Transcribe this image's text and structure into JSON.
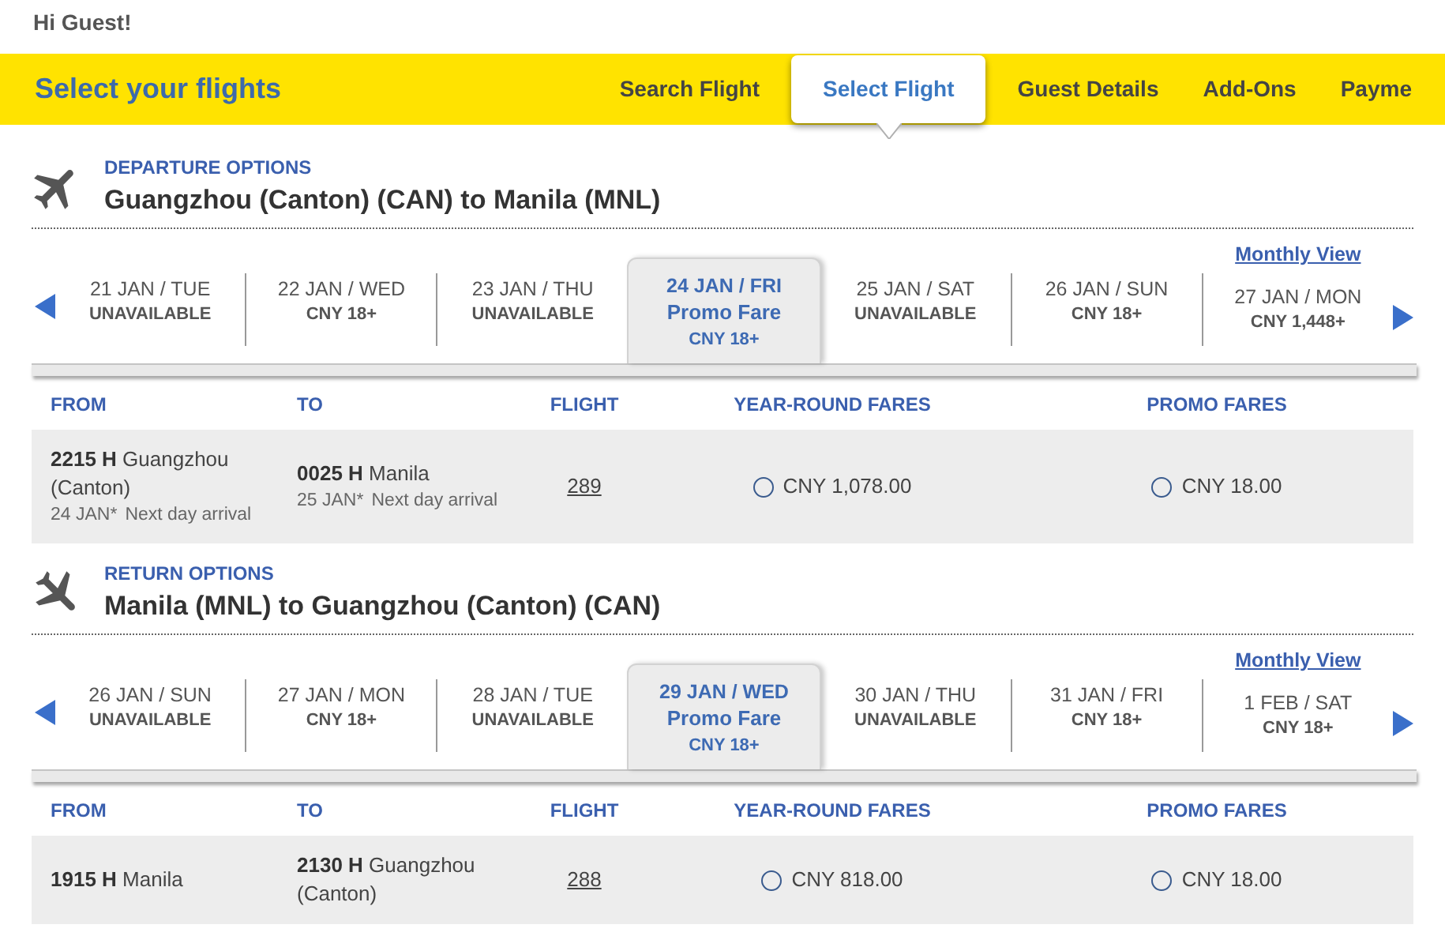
{
  "greeting": "Hi Guest!",
  "header": {
    "title": "Select your flights",
    "steps": [
      {
        "label": "Search Flight",
        "selected": false
      },
      {
        "label": "Select Flight",
        "selected": true
      },
      {
        "label": "Guest Details",
        "selected": false
      },
      {
        "label": "Add-Ons",
        "selected": false
      },
      {
        "label": "Payme",
        "selected": false
      }
    ]
  },
  "sections": [
    {
      "kind": "departure",
      "heading": "DEPARTURE OPTIONS",
      "route": "Guangzhou (Canton) (CAN) to Manila (MNL)",
      "monthly_view": "Monthly View",
      "dates": [
        {
          "date": "21 JAN / TUE",
          "fare": "UNAVAILABLE",
          "selected": false
        },
        {
          "date": "22 JAN / WED",
          "fare": "CNY 18+",
          "selected": false
        },
        {
          "date": "23 JAN / THU",
          "fare": "UNAVAILABLE",
          "selected": false
        },
        {
          "date": "24 JAN / FRI",
          "fare_type": "Promo Fare",
          "fare": "CNY 18+",
          "selected": true
        },
        {
          "date": "25 JAN / SAT",
          "fare": "UNAVAILABLE",
          "selected": false
        },
        {
          "date": "26 JAN / SUN",
          "fare": "CNY 18+",
          "selected": false
        },
        {
          "date": "27 JAN / MON",
          "fare": "CNY 1,448+",
          "selected": false
        }
      ],
      "columns": [
        "FROM",
        "TO",
        "FLIGHT",
        "YEAR-ROUND FARES",
        "PROMO FARES"
      ],
      "flights": [
        {
          "depart_time": "2215 H",
          "depart_city": "Guangzhou (Canton)",
          "depart_date": "24 JAN*",
          "depart_note": "Next day arrival",
          "arrive_time": "0025 H",
          "arrive_city": "Manila",
          "arrive_date": "25 JAN*",
          "arrive_note": "Next day arrival",
          "flight_number": "289",
          "fares": [
            {
              "price": "CNY 1,078.00",
              "selected": false
            },
            {
              "price": "CNY 18.00",
              "selected": false
            }
          ]
        }
      ]
    },
    {
      "kind": "return",
      "heading": "RETURN OPTIONS",
      "route": "Manila (MNL) to Guangzhou (Canton) (CAN)",
      "monthly_view": "Monthly View",
      "dates": [
        {
          "date": "26 JAN / SUN",
          "fare": "UNAVAILABLE",
          "selected": false
        },
        {
          "date": "27 JAN / MON",
          "fare": "CNY 18+",
          "selected": false
        },
        {
          "date": "28 JAN / TUE",
          "fare": "UNAVAILABLE",
          "selected": false
        },
        {
          "date": "29 JAN / WED",
          "fare_type": "Promo Fare",
          "fare": "CNY 18+",
          "selected": true
        },
        {
          "date": "30 JAN / THU",
          "fare": "UNAVAILABLE",
          "selected": false
        },
        {
          "date": "31 JAN / FRI",
          "fare": "CNY 18+",
          "selected": false
        },
        {
          "date": "1 FEB / SAT",
          "fare": "CNY 18+",
          "selected": false
        }
      ],
      "columns": [
        "FROM",
        "TO",
        "FLIGHT",
        "YEAR-ROUND FARES",
        "PROMO FARES"
      ],
      "flights": [
        {
          "depart_time": "1915 H",
          "depart_city": "Manila",
          "arrive_time": "2130 H",
          "arrive_city": "Guangzhou (Canton)",
          "flight_number": "288",
          "fares": [
            {
              "price": "CNY 818.00",
              "selected": false
            },
            {
              "price": "CNY 18.00",
              "selected": false
            }
          ]
        }
      ]
    }
  ]
}
